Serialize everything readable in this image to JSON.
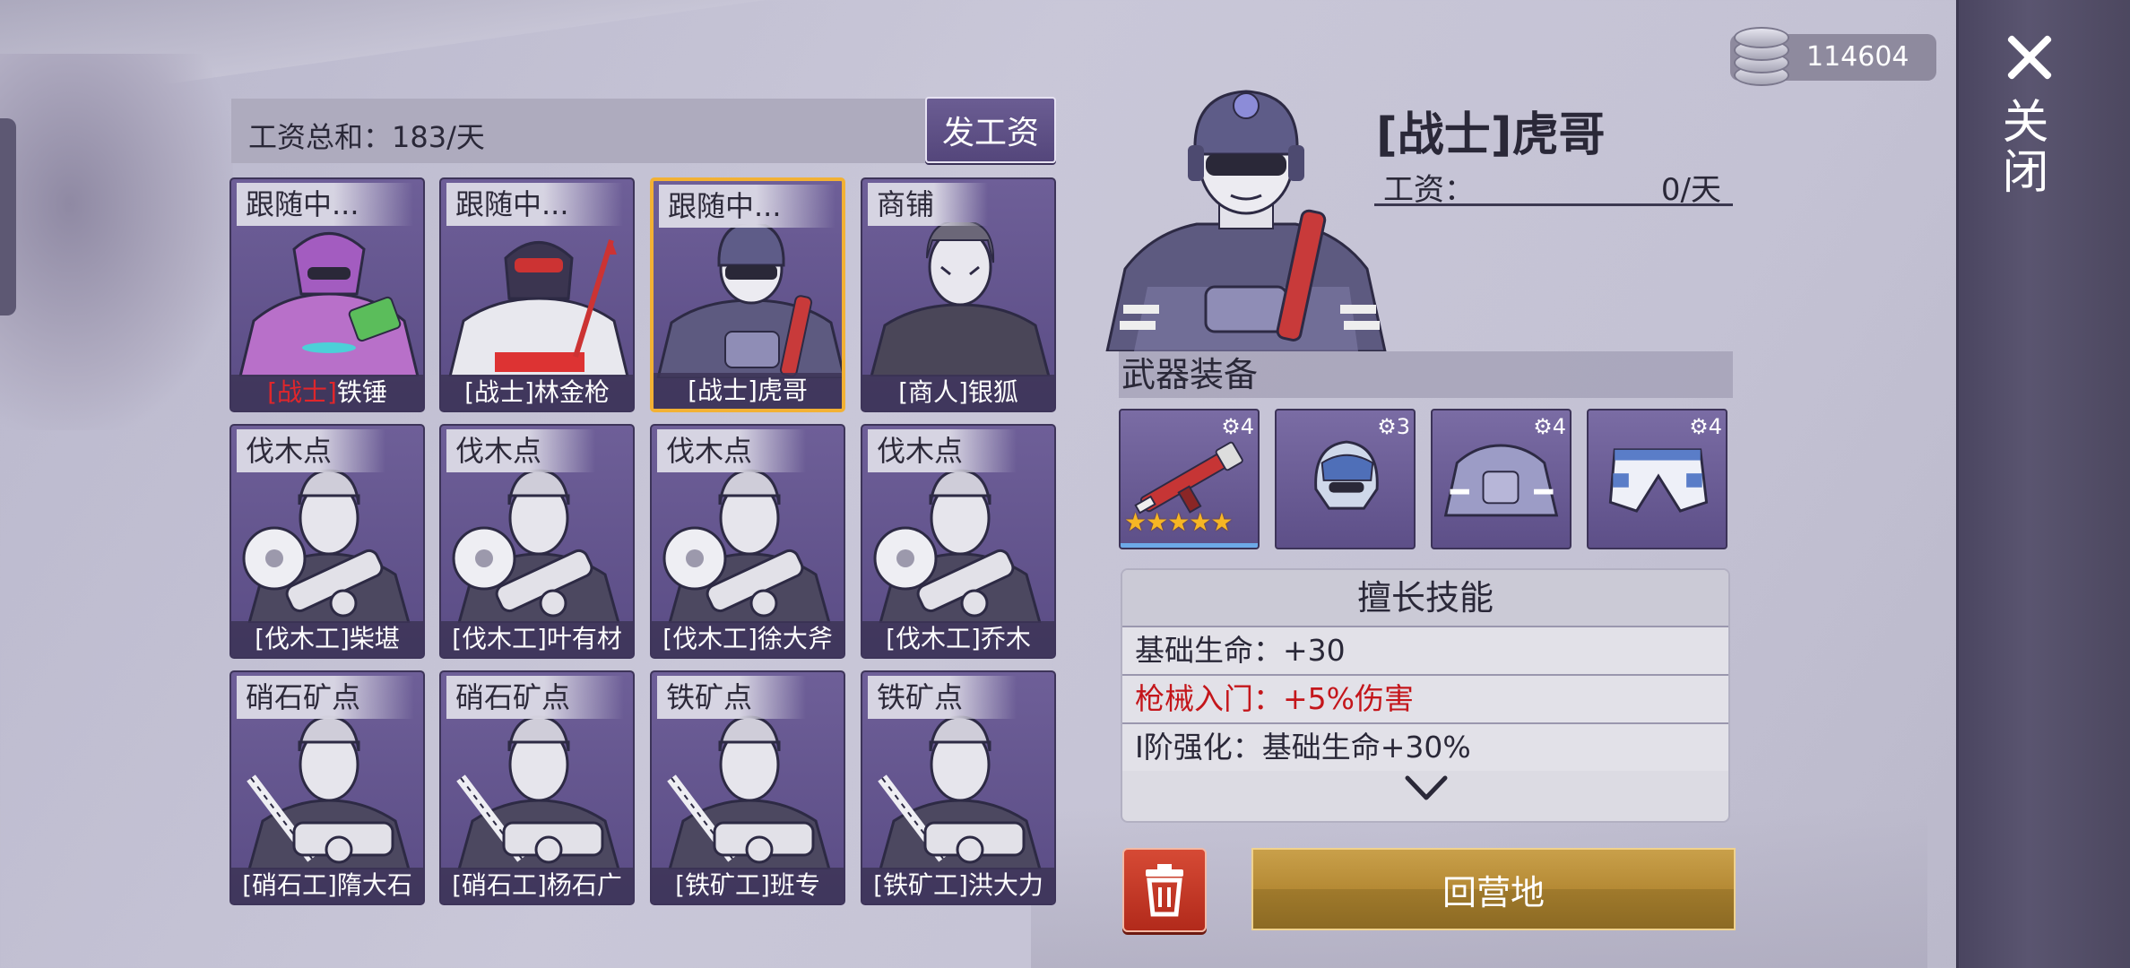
{
  "currency": {
    "value": "114604",
    "icon": "coin-stack-icon"
  },
  "close": {
    "label": "关闭"
  },
  "wage_total": {
    "label": "工资总和：183/天"
  },
  "pay_button": {
    "label": "发工资"
  },
  "cards": [
    {
      "tag": "跟随中...",
      "role": "[战士]",
      "name": "铁锤",
      "role_color": "#e0262b",
      "portrait": "purple-mech-portrait",
      "selected": false
    },
    {
      "tag": "跟随中...",
      "role": "",
      "name": "[战士]林金枪",
      "portrait": "racer-spear-portrait",
      "selected": false
    },
    {
      "tag": "跟随中...",
      "role": "",
      "name": "[战士]虎哥",
      "portrait": "armored-soldier-portrait",
      "selected": true
    },
    {
      "tag": "商铺",
      "role": "",
      "name": "[商人]银狐",
      "portrait": "merchant-portrait",
      "selected": false
    },
    {
      "tag": "伐木点",
      "role": "",
      "name": "[伐木工]柴堪",
      "portrait": "lumberjack-portrait",
      "selected": false
    },
    {
      "tag": "伐木点",
      "role": "",
      "name": "[伐木工]叶有材",
      "portrait": "lumberjack-portrait",
      "selected": false
    },
    {
      "tag": "伐木点",
      "role": "",
      "name": "[伐木工]徐大斧",
      "portrait": "lumberjack-portrait",
      "selected": false
    },
    {
      "tag": "伐木点",
      "role": "",
      "name": "[伐木工]乔木",
      "portrait": "lumberjack-portrait",
      "selected": false
    },
    {
      "tag": "硝石矿点",
      "role": "",
      "name": "[硝石工]隋大石",
      "portrait": "miner-portrait",
      "selected": false
    },
    {
      "tag": "硝石矿点",
      "role": "",
      "name": "[硝石工]杨石广",
      "portrait": "miner-portrait",
      "selected": false
    },
    {
      "tag": "铁矿点",
      "role": "",
      "name": "[铁矿工]班专",
      "portrait": "miner-portrait",
      "selected": false
    },
    {
      "tag": "铁矿点",
      "role": "",
      "name": "[铁矿工]洪大力",
      "portrait": "miner-portrait",
      "selected": false
    }
  ],
  "hero": {
    "name": "[战士]虎哥",
    "wage_label": "工资：",
    "wage_value": "0/天",
    "portrait": "armored-soldier-portrait"
  },
  "weapons": {
    "header": "武器装备",
    "slots": [
      {
        "item": "rifle-icon",
        "level": "4",
        "stars": "★★★★★",
        "star_count": 5
      },
      {
        "item": "helmet-icon",
        "level": "3"
      },
      {
        "item": "body-armor-icon",
        "level": "4"
      },
      {
        "item": "pants-icon",
        "level": "4"
      }
    ]
  },
  "skills": {
    "title": "擅长技能",
    "rows": [
      {
        "text": "基础生命：+30",
        "color": "#2a2838"
      },
      {
        "text": "枪械入门：+5%伤害",
        "color": "#c4161b"
      },
      {
        "text": "I阶强化：基础生命+30%",
        "color": "#2a2838"
      }
    ],
    "expand_icon": "chevron-down-icon"
  },
  "buttons": {
    "delete_icon": "trash-icon",
    "return_camp": "回营地"
  },
  "colors": {
    "card_bg": "#6e5f98",
    "selected_border": "#f2b134",
    "gold_button": "#b58a35",
    "delete_button": "#c83a28",
    "red_text": "#c4161b"
  }
}
